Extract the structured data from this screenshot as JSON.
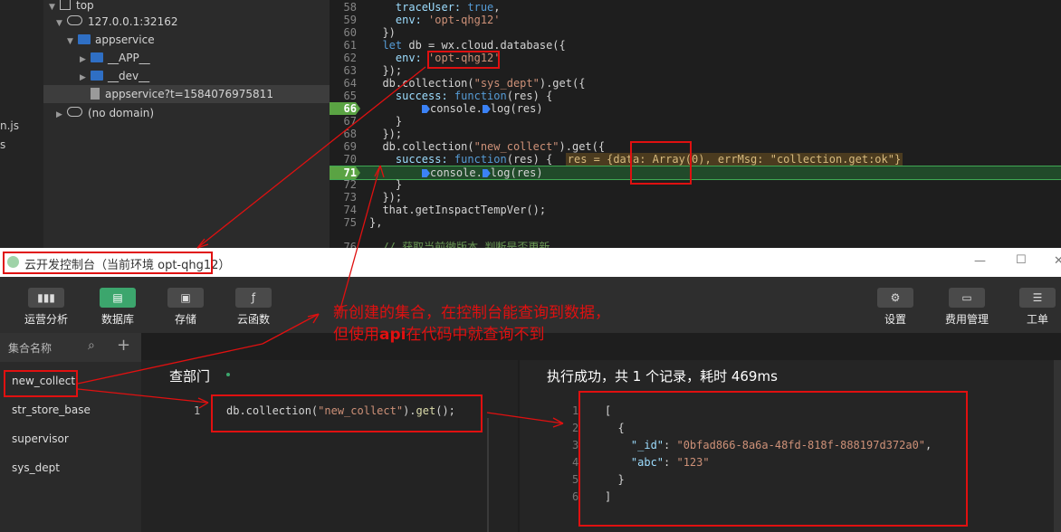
{
  "devtools": {
    "left_strip": [
      "n.js",
      "s"
    ],
    "tree": {
      "top": "top",
      "host": "127.0.0.1:32162",
      "appservice": "appservice",
      "app": "__APP__",
      "dev": "__dev__",
      "file": "appservice?t=1584076975811",
      "nodomain": "(no domain)"
    },
    "code": {
      "l58": {
        "n": "58",
        "a": "    traceUser: ",
        "b": "true",
        "c": ","
      },
      "l59": {
        "n": "59",
        "a": "    env: ",
        "b": "'opt-qhg12'"
      },
      "l60": {
        "n": "60",
        "a": "  })"
      },
      "l61": {
        "n": "61",
        "a": "  ",
        "b": "let",
        "c": " db = wx.cloud.database({"
      },
      "l62": {
        "n": "62",
        "a": "    env: ",
        "b": "'opt-qhg12'"
      },
      "l63": {
        "n": "63",
        "a": "  });"
      },
      "l64": {
        "n": "64",
        "a": "  db.collection(",
        "b": "\"sys_dept\"",
        "c": ").get({"
      },
      "l65": {
        "n": "65",
        "a": "    success: ",
        "b": "function",
        "c": "(res) {"
      },
      "l66": {
        "n": "66",
        "a": "console.",
        "b": "log(res)"
      },
      "l67": {
        "n": "67",
        "a": "    }"
      },
      "l68": {
        "n": "68",
        "a": "  });"
      },
      "l69": {
        "n": "69",
        "a": "  db.collection(",
        "b": "\"new_collect\"",
        "c": ").get({"
      },
      "l70": {
        "n": "70",
        "a": "    success: ",
        "b": "function",
        "c": "(res) {",
        "d": "res = {data: Array(0), errMsg: \"collection.get:ok\"}"
      },
      "l71": {
        "n": "71",
        "a": "console.",
        "b": "log(res)"
      },
      "l72": {
        "n": "72",
        "a": "    }"
      },
      "l73": {
        "n": "73",
        "a": "  });"
      },
      "l74": {
        "n": "74",
        "a": "  that.getInspactTempVer();"
      },
      "l75": {
        "n": "75",
        "a": "},"
      },
      "l76": {
        "n": "76",
        "a": "  // 获取当前微版本 判断是否更新"
      }
    }
  },
  "console": {
    "title": "云开发控制台（当前环境 opt-qhg12）",
    "win_min": "—",
    "win_max": "☐",
    "win_close": "✕",
    "toolbar_left": [
      {
        "label": "运营分析",
        "icon": "chart-bars-icon"
      },
      {
        "label": "数据库",
        "icon": "database-icon"
      },
      {
        "label": "存储",
        "icon": "storage-icon"
      },
      {
        "label": "云函数",
        "icon": "cloud-function-icon"
      }
    ],
    "toolbar_right": [
      {
        "label": "设置",
        "icon": "gear-icon"
      },
      {
        "label": "费用管理",
        "icon": "billing-icon"
      },
      {
        "label": "工单",
        "icon": "ticket-icon"
      }
    ],
    "sidebar": {
      "header": "集合名称",
      "items": [
        "new_collect",
        "str_store_base",
        "supervisor",
        "sys_dept"
      ]
    },
    "query": {
      "title": "查部门",
      "line_no": "1",
      "code_a": "db.collection(",
      "code_b": "\"new_collect\"",
      "code_c": ").",
      "code_d": "get",
      "code_e": "();"
    },
    "result": {
      "header": "执行成功，共 1 个记录，耗时 469ms",
      "line_nums": [
        "1",
        "2",
        "3",
        "4",
        "5",
        "6"
      ],
      "l1": "[",
      "l2": "  {",
      "l3_key": "\"_id\"",
      "l3_sep": ": ",
      "l3_val": "\"0bfad866-8a6a-48fd-818f-888197d372a0\"",
      "l3_end": ",",
      "l4_key": "\"abc\"",
      "l4_sep": ": ",
      "l4_val": "\"123\"",
      "l5": "  }",
      "l6": "]"
    }
  },
  "annotation": {
    "line1": "新创建的集合，在控制台能查询到数据，",
    "line2a": "但使用",
    "line2b": "api",
    "line2c": "在代码中就查询不到"
  },
  "colors": {
    "annotation": "#e01010",
    "active_tab": "#3ca66d",
    "breakpoint": "#5aa343"
  }
}
